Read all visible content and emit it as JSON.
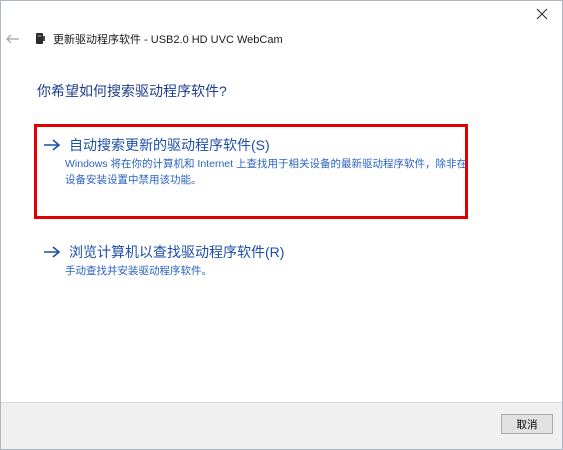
{
  "window": {
    "header_title": "更新驱动程序软件 - USB2.0 HD UVC WebCam",
    "close_glyph": "✕",
    "back_glyph": "←"
  },
  "main": {
    "question": "你希望如何搜索驱动程序软件?",
    "options": [
      {
        "label": "自动搜索更新的驱动程序软件(S)",
        "description": "Windows 将在你的计算机和 Internet 上查找用于相关设备的最新驱动程序软件，除非在设备安装设置中禁用该功能。"
      },
      {
        "label": "浏览计算机以查找驱动程序软件(R)",
        "description": "手动查找并安装驱动程序软件。"
      }
    ]
  },
  "footer": {
    "cancel_label": "取消"
  },
  "colors": {
    "link": "#1c4fa8",
    "question": "#1e3d8f",
    "highlight": "#e00000"
  }
}
